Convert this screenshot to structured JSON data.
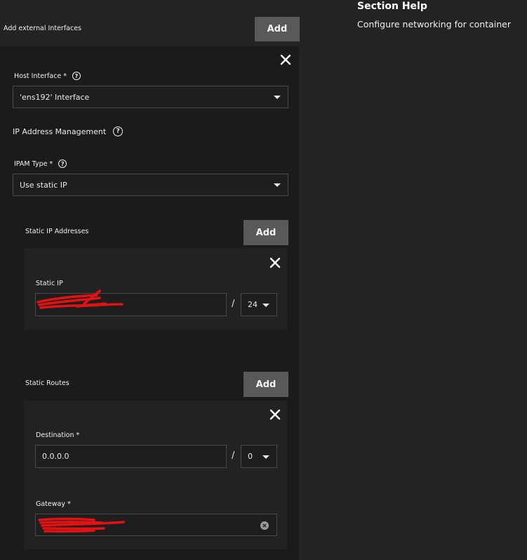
{
  "external_interfaces": {
    "label": "Add external Interfaces",
    "add_label": "Add",
    "host_interface": {
      "label": "Host Interface *",
      "value": "'ens192' Interface"
    },
    "ipam": {
      "section_title": "IP Address Management",
      "type_label": "IPAM Type *",
      "type_value": "Use static IP"
    },
    "static_ips": {
      "label": "Static IP Addresses",
      "add_label": "Add",
      "field_label": "Static IP",
      "value": "",
      "separator": "/",
      "netmask": "24"
    },
    "static_routes": {
      "label": "Static Routes",
      "add_label": "Add",
      "destination_label": "Destination *",
      "destination_value": "0.0.0.0",
      "separator": "/",
      "destination_netmask": "0",
      "gateway_label": "Gateway *",
      "gateway_value": ""
    }
  },
  "section_help": {
    "title": "Section Help",
    "text": "Configure networking for container"
  },
  "colors": {
    "background": "#232323",
    "panel": "#1b1b1b",
    "subpanel": "#222222",
    "button": "#595959",
    "redaction": "#e31212"
  },
  "icons": [
    "close-icon",
    "help-circle-icon",
    "chevron-down-icon",
    "clear-icon"
  ]
}
